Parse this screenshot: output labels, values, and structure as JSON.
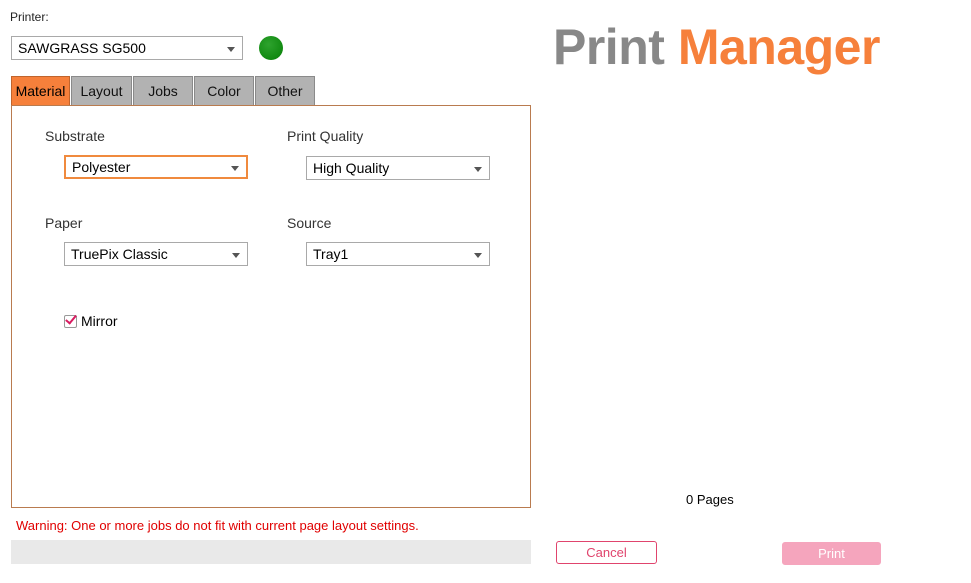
{
  "printer": {
    "label": "Printer:",
    "selected": "SAWGRASS SG500",
    "status_color": "#119911"
  },
  "brand": {
    "word1": "Print",
    "word2": "Manager",
    "color_gray": "#888888",
    "color_orange": "#f6803b"
  },
  "tabs": [
    {
      "label": "Material",
      "active": true
    },
    {
      "label": "Layout"
    },
    {
      "label": "Jobs"
    },
    {
      "label": "Color"
    },
    {
      "label": "Other"
    }
  ],
  "material": {
    "substrate": {
      "label": "Substrate",
      "value": "Polyester"
    },
    "print_quality": {
      "label": "Print Quality",
      "value": "High Quality"
    },
    "paper": {
      "label": "Paper",
      "value": "TruePix Classic"
    },
    "source": {
      "label": "Source",
      "value": "Tray1"
    },
    "mirror": {
      "label": "Mirror",
      "checked": true
    }
  },
  "warning": "Warning:  One or more jobs do not fit with current page layout settings.",
  "preview": {
    "pages_text": "0 Pages"
  },
  "buttons": {
    "cancel": "Cancel",
    "print": "Print"
  }
}
